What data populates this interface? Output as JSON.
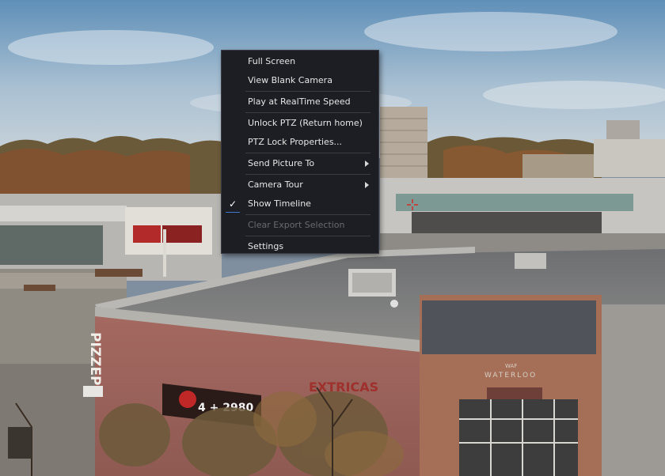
{
  "camera": {
    "sign_vertical": "PIZZEP",
    "store_sign": "WATERLOO",
    "store_small_top": "WAF",
    "restaurant_sign": "4 + 2980",
    "red_banner": "EXTRICAS"
  },
  "context_menu": {
    "items": [
      {
        "label": "Full Screen"
      },
      {
        "label": "View Blank Camera"
      },
      {
        "label": "Play at RealTime Speed"
      },
      {
        "label": "Unlock PTZ (Return home)"
      },
      {
        "label": "PTZ Lock Properties..."
      },
      {
        "label": "Send Picture To"
      },
      {
        "label": "Camera Tour"
      },
      {
        "label": "Show Timeline",
        "checked": true
      },
      {
        "label": "Clear Export Selection",
        "disabled": true
      },
      {
        "label": "Settings"
      }
    ]
  },
  "colors": {
    "menu_bg": "#1d1e23",
    "menu_text": "#e6e6e6",
    "disabled_text": "#6a6a6e",
    "check_underline": "#3f78c8",
    "crosshair": "#d42a2a"
  }
}
